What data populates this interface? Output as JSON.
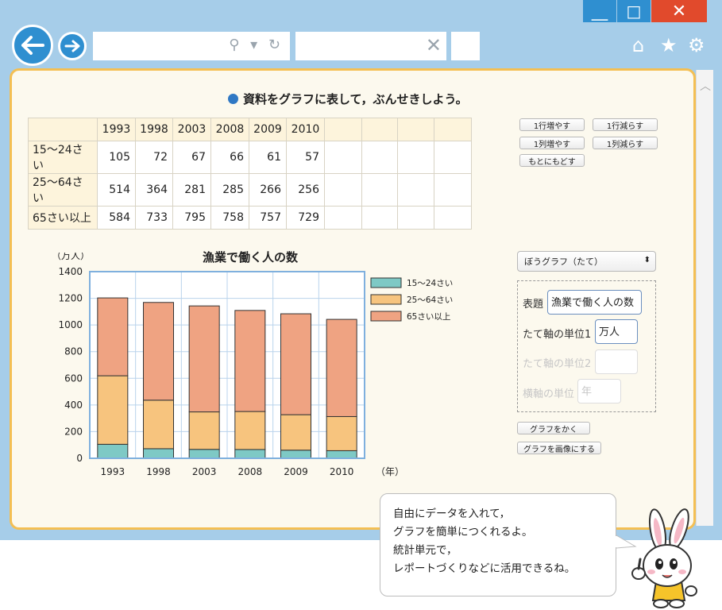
{
  "window": {
    "minimize": "＿",
    "maximize": "□",
    "close": "✕"
  },
  "toolbar": {
    "back_icon": "arrow-left-icon",
    "forward_icon": "arrow-right-icon",
    "address_icons": "⚲ ▾ ↻",
    "tab_close": "✕",
    "home": "⌂",
    "star": "★",
    "gear": "⚙"
  },
  "page": {
    "heading": "資料をグラフに表して，ぶんせきしよう。",
    "table": {
      "header": [
        "",
        "1993",
        "1998",
        "2003",
        "2008",
        "2009",
        "2010",
        "",
        "",
        "",
        ""
      ],
      "rows": [
        {
          "label": "15〜24さい",
          "values": [
            "105",
            "72",
            "67",
            "66",
            "61",
            "57"
          ]
        },
        {
          "label": "25〜64さい",
          "values": [
            "514",
            "364",
            "281",
            "285",
            "266",
            "256"
          ]
        },
        {
          "label": "65さい以上",
          "values": [
            "584",
            "733",
            "795",
            "758",
            "757",
            "729"
          ]
        }
      ]
    },
    "buttons": {
      "add_row": "1行増やす",
      "remove_row": "1行減らす",
      "add_col": "1列増やす",
      "remove_col": "1列減らす",
      "reset": "もとにもどす",
      "draw_graph": "グラフをかく",
      "save_image": "グラフを画像にする"
    },
    "graph_type": {
      "selected": "ぼうグラフ（たて）"
    },
    "options": {
      "title_label": "表題",
      "title_value": "漁業で働く人の数",
      "y_unit1_label": "たて軸の単位1",
      "y_unit1_value": "万人",
      "y_unit2_label": "たて軸の単位2",
      "y_unit2_value": "",
      "x_unit_label": "横軸の単位",
      "x_unit_value": "年"
    }
  },
  "chart_data": {
    "type": "bar",
    "stacked": true,
    "title": "漁業で働く人の数",
    "ylabel": "（万人）",
    "xlabel": "（年）",
    "categories": [
      "1993",
      "1998",
      "2003",
      "2008",
      "2009",
      "2010"
    ],
    "ylim": [
      0,
      1400
    ],
    "yticks": [
      0,
      200,
      400,
      600,
      800,
      1000,
      1200,
      1400
    ],
    "grid": true,
    "legend_position": "right",
    "series": [
      {
        "name": "15〜24さい",
        "values": [
          105,
          72,
          67,
          66,
          61,
          57
        ],
        "color": "#7ec9c5"
      },
      {
        "name": "25〜64さい",
        "values": [
          514,
          364,
          281,
          285,
          266,
          256
        ],
        "color": "#f7c47e"
      },
      {
        "name": "65さい以上",
        "values": [
          584,
          733,
          795,
          758,
          757,
          729
        ],
        "color": "#efa382"
      }
    ]
  },
  "bubble": {
    "lines": [
      "自由にデータを入れて，",
      "グラフを簡単につくれるよ。",
      "統計単元で，",
      "レポートづくりなどに活用できるね。"
    ]
  }
}
